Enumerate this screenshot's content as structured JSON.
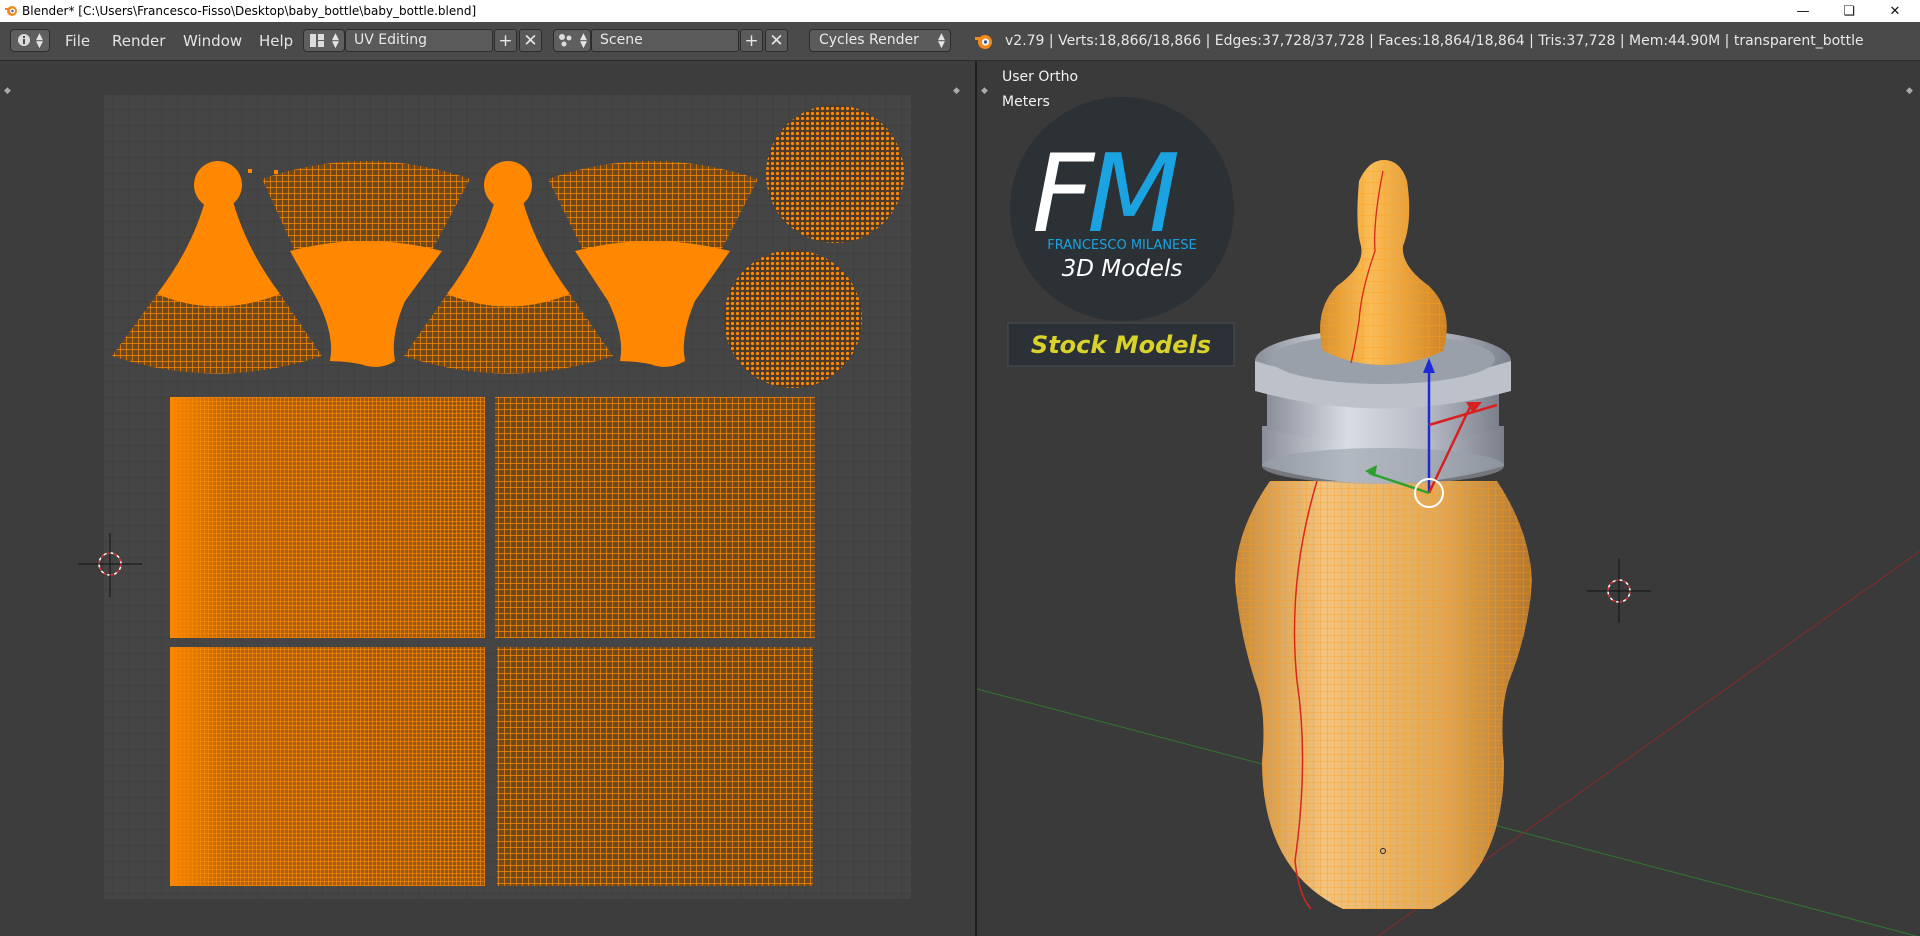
{
  "titlebar": {
    "title": "Blender* [C:\\Users\\Francesco-Fisso\\Desktop\\baby_bottle\\baby_bottle.blend]",
    "minimize_icon": "minimize-icon",
    "maximize_icon": "restore-icon",
    "close_icon": "close-icon"
  },
  "header": {
    "menus": [
      "File",
      "Render",
      "Window",
      "Help"
    ],
    "screen_layout": "UV Editing",
    "scene": "Scene",
    "render_engine": "Cycles Render",
    "stats": "v2.79 | Verts:18,866/18,866 | Edges:37,728/37,728 | Faces:18,864/18,864 | Tris:37,728 | Mem:44.90M | transparent_bottle"
  },
  "viewport": {
    "view_name": "User Ortho",
    "units": "Meters"
  },
  "logo": {
    "letters_f": "F",
    "letters_m": "M",
    "brand": "FRANCESCO MILANESE",
    "tagline": "3D Models",
    "banner": "Stock Models"
  },
  "colors": {
    "uv_orange": "#ff8800",
    "header_bg": "#4a4a4a",
    "seam_red": "#e02020",
    "logo_blue": "#1aa3e0",
    "banner_yellow": "#d8d22a"
  }
}
